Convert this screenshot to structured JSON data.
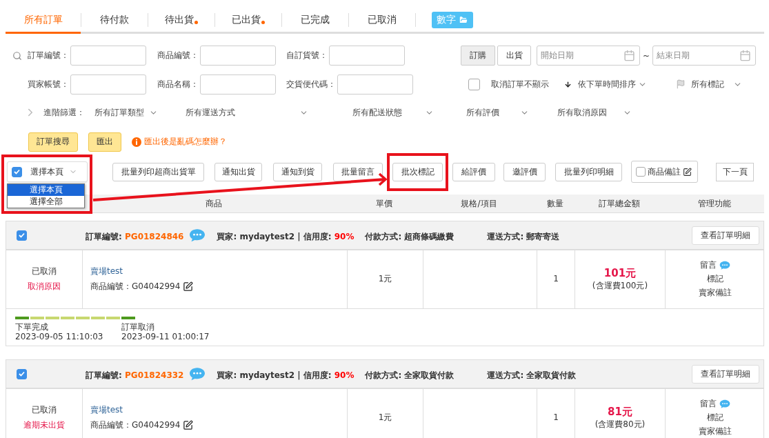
{
  "tabs": [
    {
      "label": "所有訂單",
      "selected": true,
      "alert": false
    },
    {
      "label": "待付款",
      "selected": false,
      "alert": false
    },
    {
      "label": "待出貨",
      "selected": false,
      "alert": true
    },
    {
      "label": "已出貨",
      "selected": false,
      "alert": true
    },
    {
      "label": "已完成",
      "selected": false,
      "alert": false
    },
    {
      "label": "已取消",
      "selected": false,
      "alert": false
    }
  ],
  "digit_button": {
    "label": "數字"
  },
  "search_fields": [
    [
      {
        "label": "訂單編號："
      },
      {
        "label": "商品編號："
      },
      {
        "label": "自訂貨號："
      }
    ],
    [
      {
        "label": "買家帳號："
      },
      {
        "label": "商品名稱："
      },
      {
        "label": "交貨便代碼："
      }
    ]
  ],
  "date_mode": [
    {
      "label": "訂購",
      "selected": true
    },
    {
      "label": "出貨",
      "selected": false
    }
  ],
  "date_range": {
    "start_placeholder": "開始日期",
    "separator": "~",
    "end_placeholder": "結束日期"
  },
  "hide_cancelled": {
    "label": "取消訂單不顯示",
    "checked": false
  },
  "sort": {
    "label": "依下單時間排序"
  },
  "mark_filter": {
    "label": "所有標記"
  },
  "advanced_filter": {
    "label": "進階篩選：",
    "options": [
      "所有訂單類型",
      "所有運送方式",
      "所有配送狀態",
      "所有評價",
      "所有取消原因"
    ]
  },
  "search_button": "訂單搜尋",
  "export_button": "匯出",
  "export_help": "匯出後是亂碼怎麼辦？",
  "bulk": {
    "select": {
      "label": "選擇本頁",
      "checked": true,
      "menu": [
        {
          "label": "選擇本頁",
          "selected": true
        },
        {
          "label": "選擇全部",
          "selected": false
        }
      ]
    },
    "buttons": [
      "批量列印超商出貨單",
      "通知出貨",
      "通知到貨",
      "批量留言",
      "批次標記",
      "給評價",
      "邀評價",
      "批量列印明細"
    ],
    "note_toggle": {
      "label": "商品備註",
      "checked": false
    },
    "next_page": "下一頁"
  },
  "table": {
    "columns": [
      "商品",
      "單價",
      "規格/項目",
      "數量",
      "訂單總金額",
      "管理功能"
    ]
  },
  "orders": [
    {
      "checked": true,
      "order_label": "訂單編號:",
      "order_no": "PG01824846",
      "buyer": "買家: mydaytest2 | 信用度:",
      "credit": "90%",
      "payment": "付款方式: 超商條碼繳費",
      "shipping": "運送方式: 郵寄寄送",
      "detail_button": "查看訂單明細",
      "status": "已取消",
      "status_reason": "取消原因",
      "product": "賣場test",
      "product_no": "商品編號：G04042994",
      "price": "1元",
      "quantity": "1",
      "total": "101元",
      "fee_note": "(含運費100元)",
      "actions": [
        "留言",
        "標記",
        "賣家備註"
      ],
      "timeline": {
        "segments": [
          {
            "reached": true
          },
          {
            "reached": false
          },
          {
            "reached": false
          },
          {
            "reached": false
          },
          {
            "reached": false
          },
          {
            "reached": false
          },
          {
            "reached": false
          },
          {
            "reached": true
          }
        ],
        "events": [
          {
            "label": "下單完成",
            "time": "2023-09-05 11:10:03"
          },
          {
            "label": "訂單取消",
            "time": "2023-09-11 01:00:17"
          }
        ]
      }
    },
    {
      "checked": true,
      "order_label": "訂單編號:",
      "order_no": "PG01824332",
      "buyer": "買家: mydaytest2 | 信用度:",
      "credit": "90%",
      "payment": "付款方式: 全家取貨付款",
      "shipping": "運送方式: 全家取貨付款",
      "detail_button": "查看訂單明細",
      "status": "已取消",
      "status_reason": "逾期未出貨",
      "product": "賣場test",
      "product_no": "商品編號：G04042994",
      "price": "1元",
      "quantity": "1",
      "total": "81元",
      "fee_note": "(含運費80元)",
      "actions": [
        "留言",
        "標記",
        "賣家備註"
      ]
    }
  ]
}
